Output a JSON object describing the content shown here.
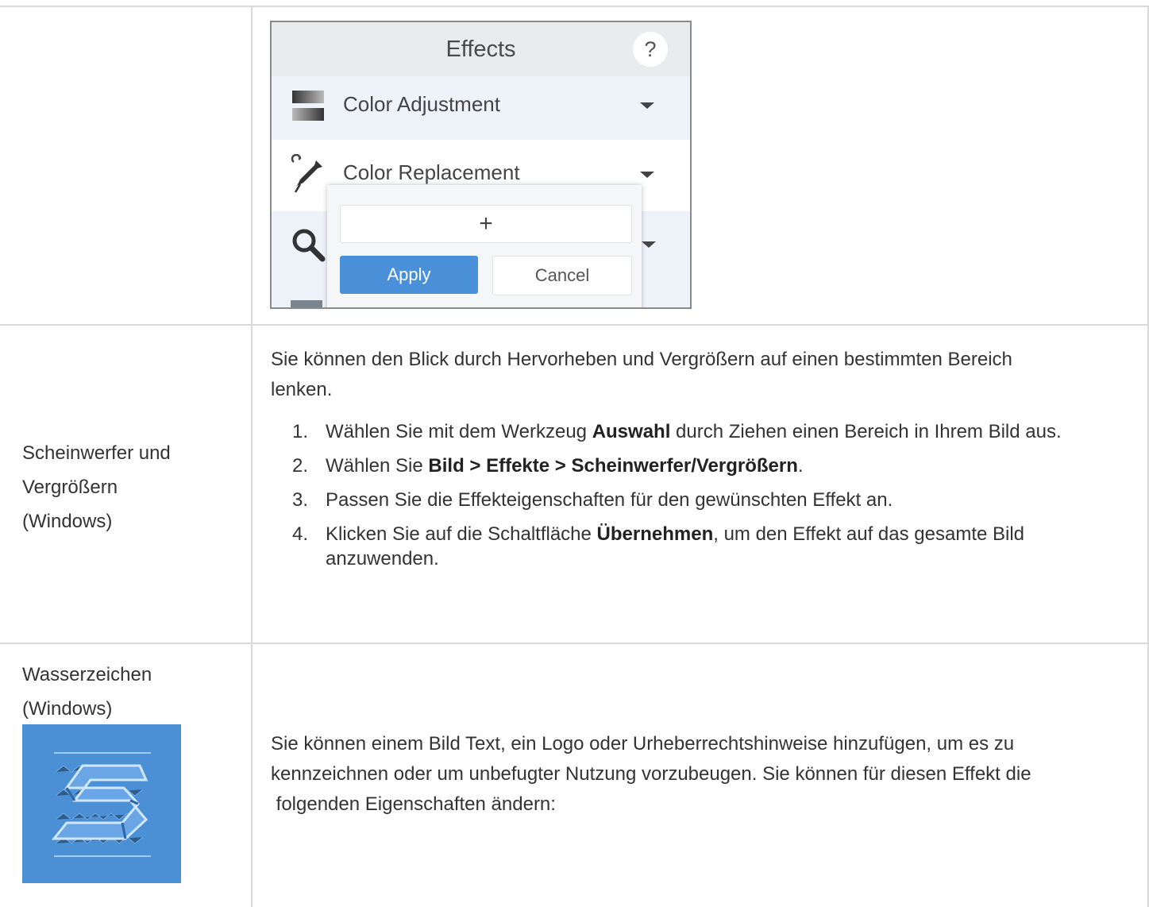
{
  "effects_panel": {
    "title": "Effects",
    "help_label": "?",
    "items": [
      {
        "label": "Color Adjustment",
        "icon": "color-adjustment-icon"
      },
      {
        "label": "Color Replacement",
        "icon": "eyedropper-icon"
      },
      {
        "label": "",
        "icon": "magnify-icon"
      }
    ],
    "popup": {
      "add_label": "+",
      "apply_label": "Apply",
      "cancel_label": "Cancel"
    },
    "colors": {
      "header": "#e9ebed",
      "apply": "#4a90d9",
      "row_highlight": "#eef3fa"
    }
  },
  "rows": [
    {
      "name": "Scheinwerfer und Vergrößern (Windows)",
      "name_lines": [
        "Scheinwerfer und",
        "Vergrößern",
        "(Windows)"
      ],
      "intro_lines": [
        "Sie können den Blick durch Hervorheben und Vergrößern auf einen bestimmten Bereich",
        "lenken."
      ],
      "steps": [
        {
          "num": "1.",
          "pre": "Wählen Sie mit dem Werkzeug ",
          "bold": "Auswahl",
          "post": " durch Ziehen einen Bereich in Ihrem Bild aus."
        },
        {
          "num": "2.",
          "pre": "Wählen Sie ",
          "bold": "Bild > Effekte > Scheinwerfer/Vergrößern",
          "post": "."
        },
        {
          "num": "3.",
          "pre": "Passen Sie die Effekteigenschaften für den gewünschten Effekt an.",
          "bold": "",
          "post": ""
        },
        {
          "num": "4.",
          "pre": "Klicken Sie auf die Schaltfläche ",
          "bold": "Übernehmen",
          "post": ", um den Effekt auf das gesamte Bild anzuwenden."
        }
      ]
    },
    {
      "name": "Wasserzeichen (Windows)",
      "name_lines": [
        "Wasserzeichen",
        "(Windows)"
      ],
      "icon": "watermark-icon",
      "text_lines": [
        "Sie können einem Bild Text, ein Logo oder Urheberrechtshinweise hinzufügen, um es zu",
        "kennzeichnen oder um unbefugter Nutzung vorzubeugen. Sie können für diesen Effekt die",
        " folgenden Eigenschaften ändern:"
      ]
    }
  ]
}
